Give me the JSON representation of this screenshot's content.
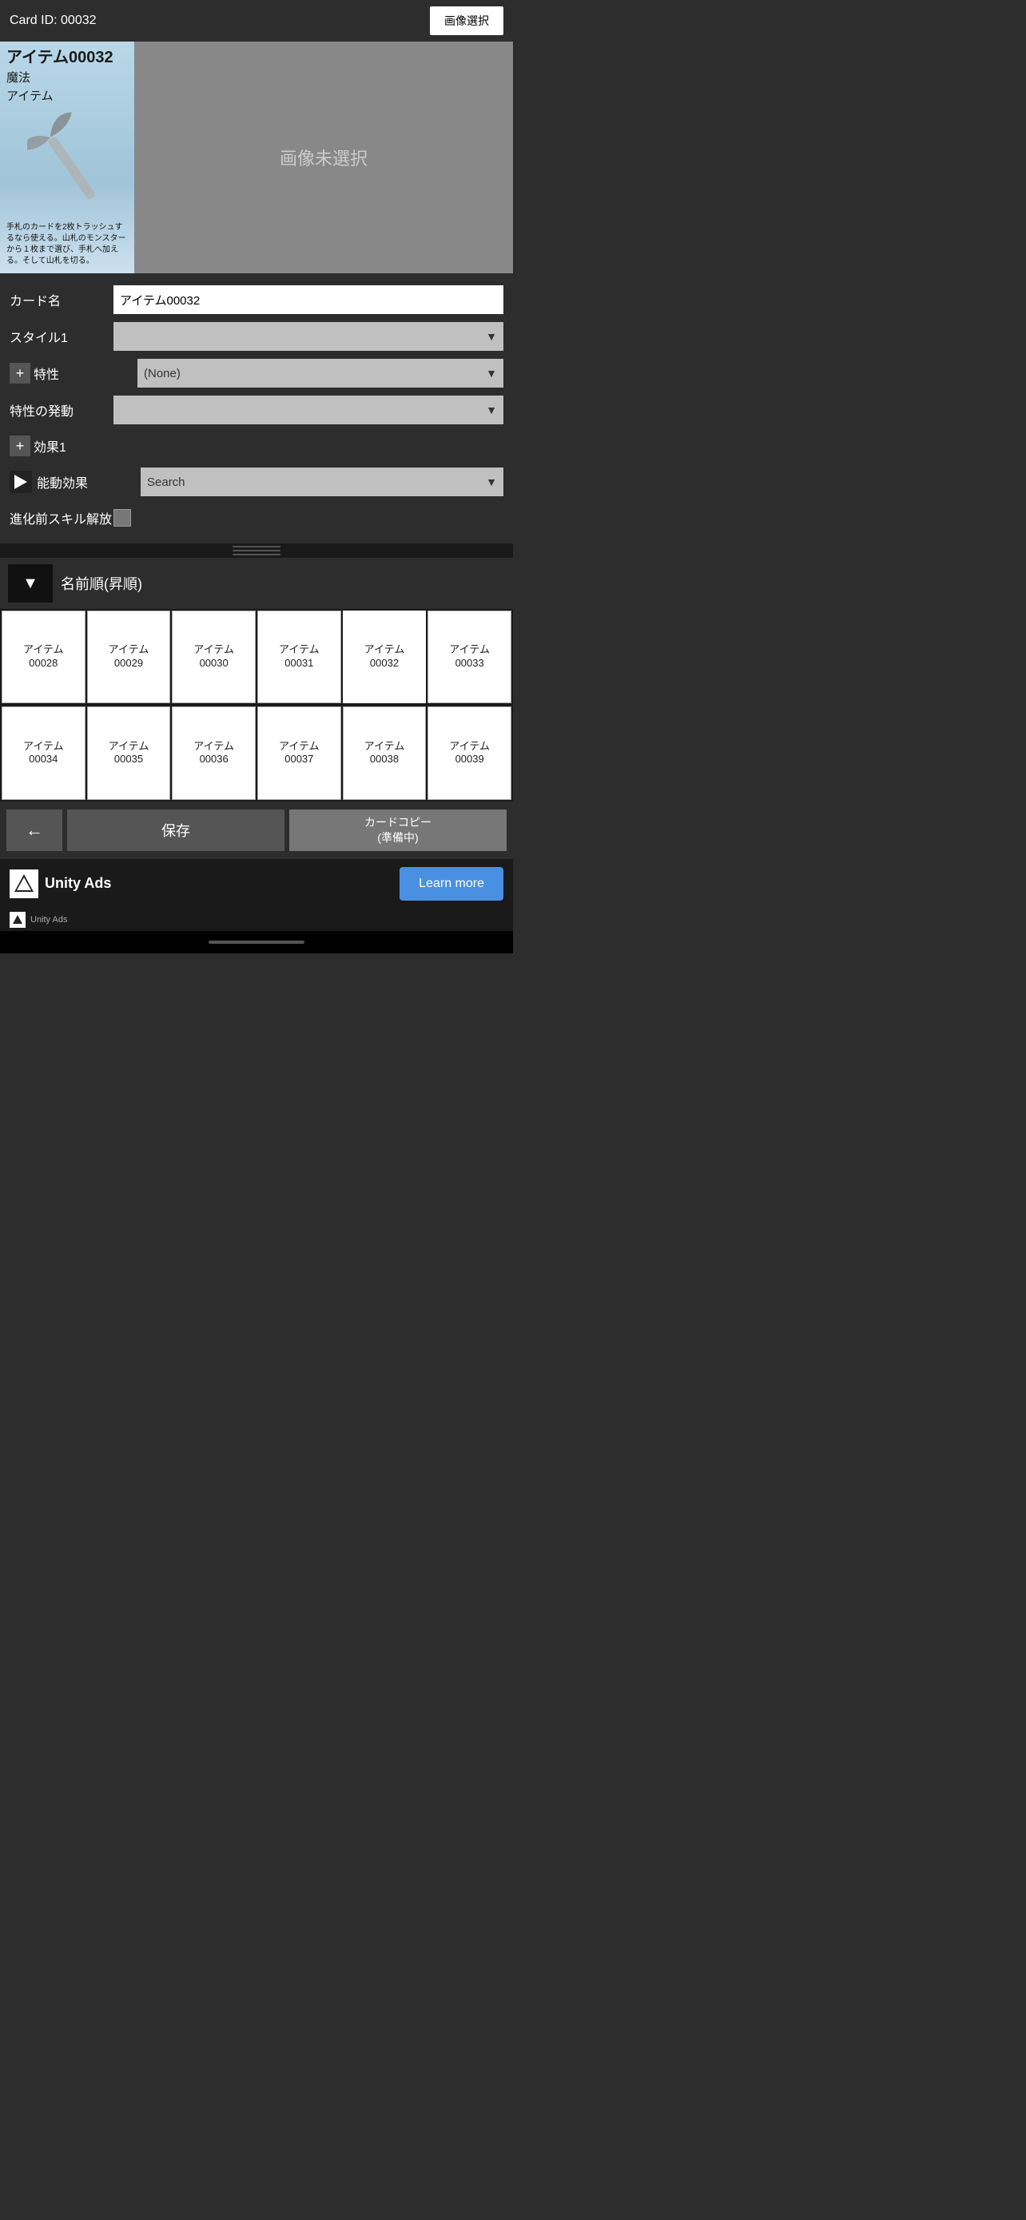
{
  "cardIdBar": {
    "label": "Card ID: 00032",
    "selectImageBtn": "画像選択"
  },
  "cardPreview": {
    "title": "アイテム00032",
    "typeLine1": "魔法",
    "typeLine2": "アイテム",
    "description": "手札のカードを2枚トラッシュするなら使える。山札のモンスターから１枚まで選び、手札へ加える。そして山札を切る。",
    "noImageText": "画像未選択"
  },
  "form": {
    "cardNameLabel": "カード名",
    "cardNameValue": "アイテム00032",
    "style1Label": "スタイル1",
    "style1Value": "",
    "traitLabel": "特性",
    "traitValue": "(None)",
    "traitTriggerLabel": "特性の発動",
    "traitTriggerValue": "",
    "effect1Label": "効果1",
    "activeEffectLabel": "能動効果",
    "activeEffectValue": "Search",
    "skillReleaseLabel": "進化前スキル解放"
  },
  "sortBar": {
    "dropdownLabel": "▼",
    "sortLabel": "名前順(昇順)"
  },
  "cardGrid": {
    "row1": [
      {
        "name": "アイテム\n00028"
      },
      {
        "name": "アイテム\n00029"
      },
      {
        "name": "アイテム\n00030"
      },
      {
        "name": "アイテム\n00031"
      },
      {
        "name": "アイテム\n00032"
      },
      {
        "name": "アイテム\n00033"
      }
    ],
    "row2": [
      {
        "name": "アイテム\n00034"
      },
      {
        "name": "アイテム\n00035"
      },
      {
        "name": "アイテム\n00036"
      },
      {
        "name": "アイテム\n00037"
      },
      {
        "name": "アイテム\n00038"
      },
      {
        "name": "アイテム\n00039"
      }
    ]
  },
  "bottomButtons": {
    "backLabel": "←",
    "saveLabel": "保存",
    "copyLabel": "カードコピー\n(準備中)"
  },
  "adBanner": {
    "brandName": "Unity Ads",
    "learnMoreLabel": "Learn more",
    "smallText": "Unity  Ads"
  }
}
